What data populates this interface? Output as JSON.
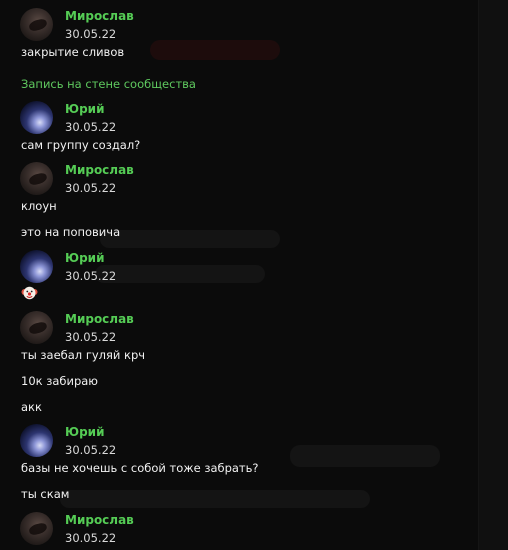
{
  "messages": [
    {
      "author": "Мирослав",
      "date": "30.05.22",
      "lines": [
        "закрытие сливов"
      ]
    },
    {
      "link": "Запись на стене сообщества"
    },
    {
      "author": "Юрий",
      "date": "30.05.22",
      "lines": [
        "сам группу создал?"
      ]
    },
    {
      "author": "Мирослав",
      "date": "30.05.22",
      "lines": [
        "клоун",
        "это на поповича"
      ]
    },
    {
      "author": "Юрий",
      "date": "30.05.22",
      "emoji": "clown-face"
    },
    {
      "author": "Мирослав",
      "date": "30.05.22",
      "lines": [
        "ты заебал гуляй крч",
        "10к забираю",
        "акк"
      ]
    },
    {
      "author": "Юрий",
      "date": "30.05.22",
      "lines": [
        "базы не хочешь с собой тоже забрать?",
        "ты скам"
      ]
    },
    {
      "author": "Мирослав",
      "date": "30.05.22"
    }
  ],
  "colors": {
    "name": "#55cc55",
    "link": "#5fc95f",
    "background": "#0b0b0b",
    "text": "#f2f2f2"
  }
}
